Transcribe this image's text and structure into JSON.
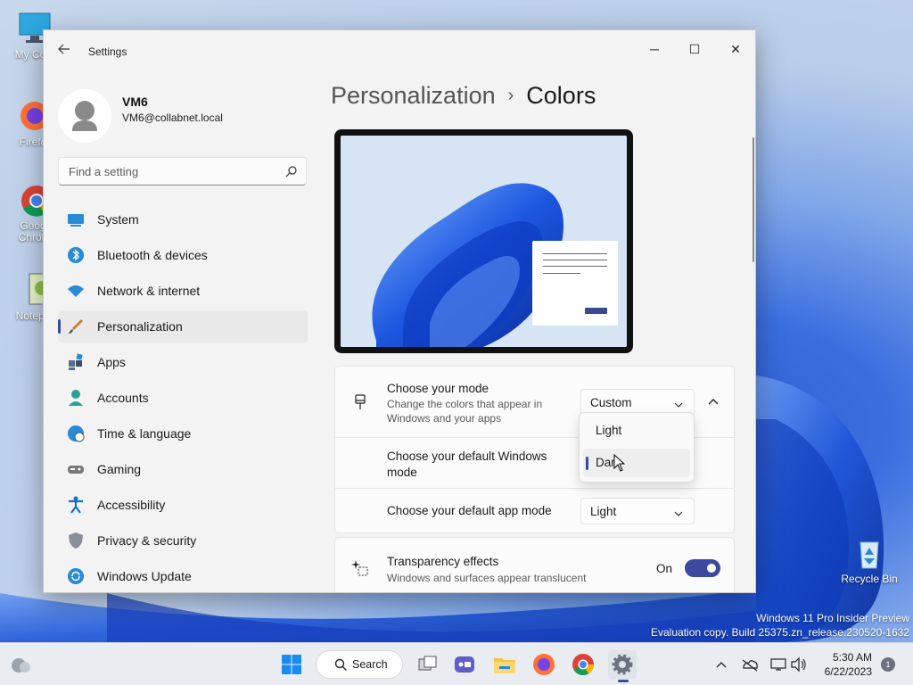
{
  "desktop": {
    "icons": [
      {
        "label": "My Com"
      },
      {
        "label": "Firefo"
      },
      {
        "label": "Goog\nChron"
      },
      {
        "label": "Notepa"
      },
      {
        "label": "Recycle Bin"
      }
    ],
    "watermark": {
      "line1": "Windows 11 Pro Insider Preview",
      "line2": "Evaluation copy. Build 25375.zn_release.230520-1632"
    }
  },
  "window": {
    "title": "Settings",
    "controls": {
      "minimize": "─",
      "maximize": "☐",
      "close": "✕"
    }
  },
  "user": {
    "name": "VM6",
    "email": "VM6@collabnet.local"
  },
  "search": {
    "placeholder": "Find a setting"
  },
  "nav": {
    "items": [
      {
        "label": "System",
        "icon": "system-icon"
      },
      {
        "label": "Bluetooth & devices",
        "icon": "bluetooth-icon"
      },
      {
        "label": "Network & internet",
        "icon": "network-icon"
      },
      {
        "label": "Personalization",
        "icon": "personalization-icon",
        "active": true
      },
      {
        "label": "Apps",
        "icon": "apps-icon"
      },
      {
        "label": "Accounts",
        "icon": "accounts-icon"
      },
      {
        "label": "Time & language",
        "icon": "time-icon"
      },
      {
        "label": "Gaming",
        "icon": "gaming-icon"
      },
      {
        "label": "Accessibility",
        "icon": "accessibility-icon"
      },
      {
        "label": "Privacy & security",
        "icon": "shield-icon"
      },
      {
        "label": "Windows Update",
        "icon": "update-icon"
      }
    ]
  },
  "main": {
    "breadcrumb_parent": "Personalization",
    "breadcrumb_sep": "›",
    "breadcrumb_current": "Colors",
    "mode": {
      "title": "Choose your mode",
      "subtitle": "Change the colors that appear in Windows and your apps",
      "value": "Custom"
    },
    "windows_mode": {
      "title": "Choose your default Windows mode",
      "options": [
        "Light",
        "Dark"
      ],
      "selected": "Dark"
    },
    "app_mode": {
      "title": "Choose your default app mode",
      "value": "Light"
    },
    "transparency": {
      "title": "Transparency effects",
      "subtitle": "Windows and surfaces appear translucent",
      "state": "On"
    }
  },
  "taskbar": {
    "search_label": "Search",
    "time": "5:30 AM",
    "date": "6/22/2023",
    "notifications": "1"
  },
  "colors": {
    "accent": "#3b4aa0"
  }
}
